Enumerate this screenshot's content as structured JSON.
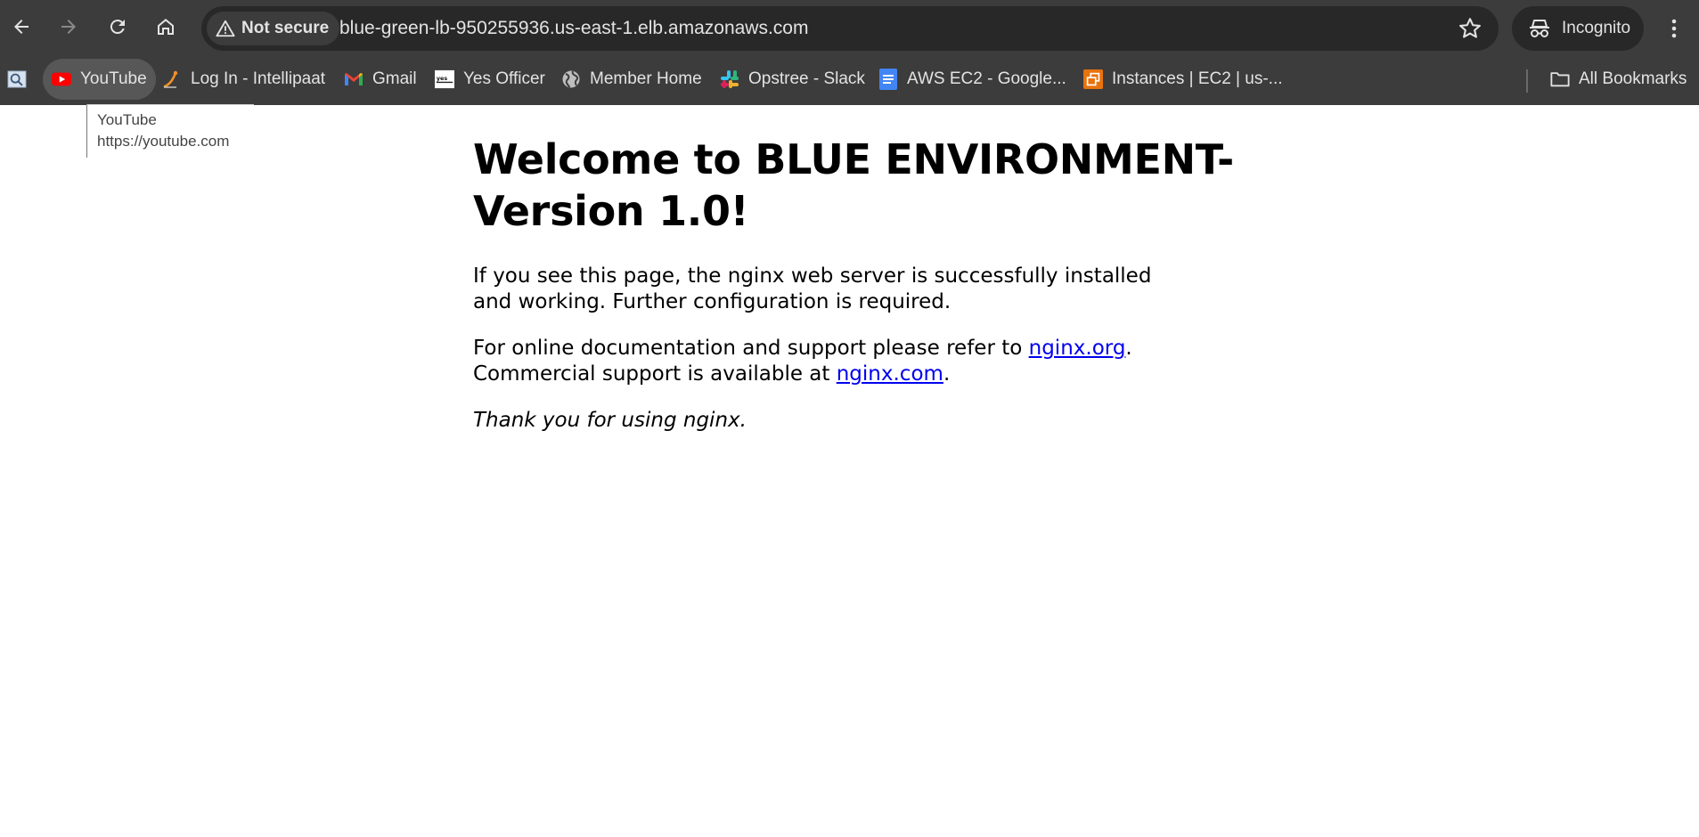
{
  "browser": {
    "omnibox": {
      "security_label": "Not secure",
      "url": "blue-green-lb-950255936.us-east-1.elb.amazonaws.com"
    },
    "profile_label": "Incognito"
  },
  "bookmarks": {
    "items": [
      {
        "label": "",
        "icon": "doc-magnifier-icon"
      },
      {
        "label": "YouTube",
        "icon": "youtube-icon"
      },
      {
        "label": "Log In - Intellipaat",
        "icon": "intellipaat-icon"
      },
      {
        "label": "Gmail",
        "icon": "gmail-icon"
      },
      {
        "label": "Yes Officer",
        "icon": "yes-officer-icon"
      },
      {
        "label": "Member Home",
        "icon": "globe-icon"
      },
      {
        "label": "Opstree - Slack",
        "icon": "slack-icon"
      },
      {
        "label": "AWS EC2 - Google...",
        "icon": "google-docs-icon"
      },
      {
        "label": "Instances | EC2 | us-...",
        "icon": "aws-ec2-icon"
      }
    ],
    "all_bookmarks_label": "All Bookmarks"
  },
  "tooltip": {
    "title": "YouTube",
    "url": "https://youtube.com"
  },
  "page": {
    "heading": "Welcome to BLUE ENVIRONMENT-Version 1.0!",
    "para1": "If you see this page, the nginx web server is successfully installed and working. Further configuration is required.",
    "para2_prefix": "For online documentation and support please refer to ",
    "link_org": "nginx.org",
    "para2_mid": ".",
    "para2_line2_prefix": "Commercial support is available at ",
    "link_com": "nginx.com",
    "para2_suffix": ".",
    "thanks": "Thank you for using nginx."
  }
}
